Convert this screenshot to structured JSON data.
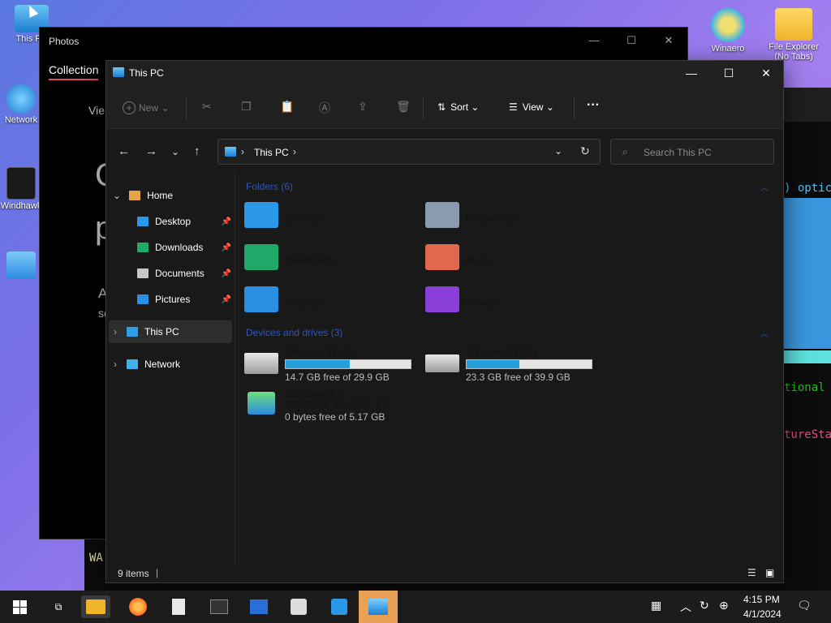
{
  "desktop": {
    "icons": [
      {
        "label": "This PC"
      },
      {
        "label": "Network"
      },
      {
        "label": "Windhawk"
      },
      {
        "label": "Winaero"
      },
      {
        "label": "File Explorer (No Tabs)"
      }
    ]
  },
  "terminal": {
    "line1": ") optic",
    "line2": "tional",
    "line3": "tureSta",
    "line4": "WA"
  },
  "photos": {
    "title": "Photos",
    "tab": "Collection",
    "view_label": "Vie",
    "big_text_1": "C",
    "big_text_2": "p",
    "small_text_1": "A",
    "small_text_2": "se"
  },
  "explorer": {
    "title": "This PC",
    "commands": {
      "new": "New",
      "sort": "Sort",
      "view": "View",
      "more": "···"
    },
    "address": {
      "location": "This PC"
    },
    "search": {
      "placeholder": "Search This PC"
    },
    "sidebar": {
      "items": [
        {
          "label": "Home"
        },
        {
          "label": "Desktop"
        },
        {
          "label": "Downloads"
        },
        {
          "label": "Documents"
        },
        {
          "label": "Pictures"
        },
        {
          "label": "This PC"
        },
        {
          "label": "Network"
        }
      ]
    },
    "folders_header": "Folders (6)",
    "folders": [
      {
        "label": "Desktop",
        "color": "#2b98e8"
      },
      {
        "label": "Documents",
        "color": "#8a9bb0"
      },
      {
        "label": "Downloads",
        "color": "#1fa867"
      },
      {
        "label": "Music",
        "color": "#e2674f"
      },
      {
        "label": "Pictures",
        "color": "#2a8fe0"
      },
      {
        "label": "Videos",
        "color": "#8a3fd8"
      }
    ],
    "drives_header": "Devices and drives (3)",
    "drives": [
      {
        "name": "Windows 11 (C:)",
        "free": "14.7 GB free of 29.9 GB",
        "used_fraction": 0.51
      },
      {
        "name": "Windows 11 (D:)",
        "free": "23.3 GB free of 39.9 GB",
        "used_fraction": 0.42
      },
      {
        "name": "CD Drive (E:)",
        "label": "CCCOMA_X64FRE_EN-US_D...",
        "free": "0 bytes free of 5.17 GB"
      }
    ],
    "status": {
      "items": "9 items"
    }
  },
  "taskbar": {
    "time": "4:15 PM",
    "date": "4/1/2024"
  },
  "colors": {
    "accent": "#26a0da",
    "group_header": "#3155b8",
    "taskbar_active": "#e8a055"
  }
}
